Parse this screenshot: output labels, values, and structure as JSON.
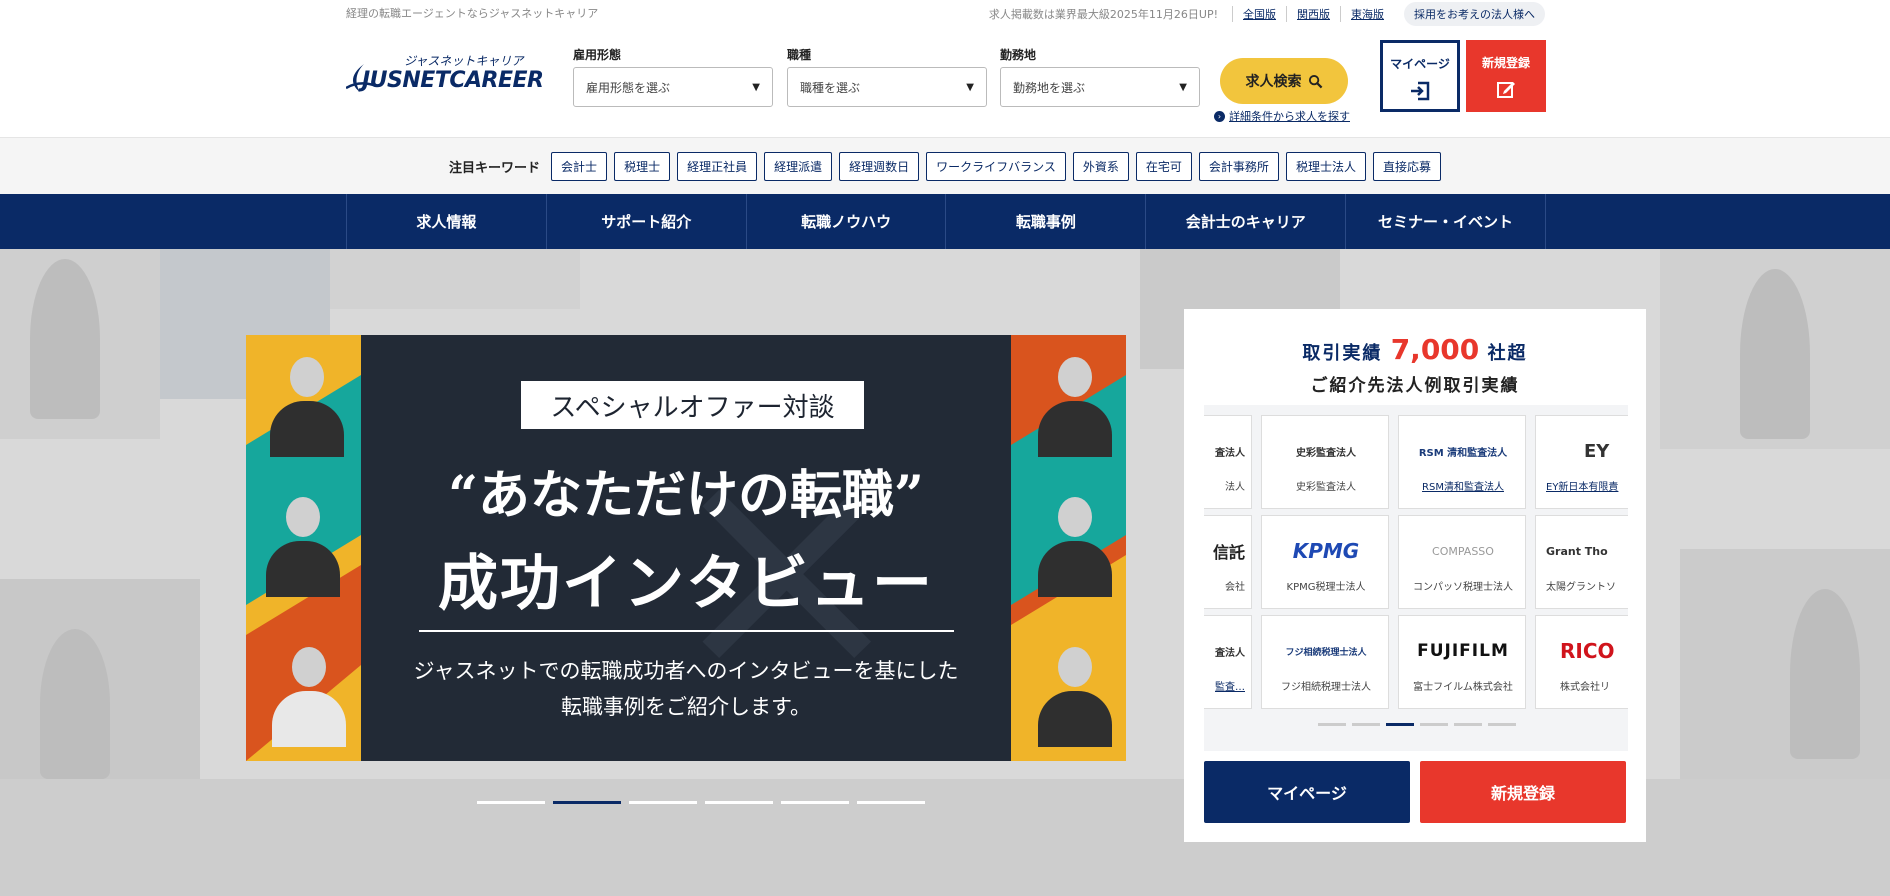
{
  "topbar": {
    "tagline": "経理の転職エージェントならジャスネットキャリア",
    "notice": "求人掲載数は業界最大級2025年11月26日UP!",
    "regions": [
      "全国版",
      "関西版",
      "東海版"
    ],
    "corporate_link": "採用をお考えの法人様へ"
  },
  "logo": {
    "ja": "ジャスネットキャリア",
    "en": "JUSNETCAREER",
    "colors": {
      "navy": "#0a2a66"
    }
  },
  "search": {
    "employment": {
      "label": "雇用形態",
      "placeholder": "雇用形態を選ぶ"
    },
    "job": {
      "label": "職種",
      "placeholder": "職種を選ぶ"
    },
    "location": {
      "label": "勤務地",
      "placeholder": "勤務地を選ぶ"
    },
    "button": "求人検索",
    "detail_link": "詳細条件から求人を探す"
  },
  "header_buttons": {
    "mypage": "マイページ",
    "register": "新規登録"
  },
  "keywords": {
    "label": "注目キーワード",
    "items": [
      "会計士",
      "税理士",
      "経理正社員",
      "経理派遣",
      "経理週数日",
      "ワークライフバランス",
      "外資系",
      "在宅可",
      "会計事務所",
      "税理士法人",
      "直接応募"
    ]
  },
  "nav": [
    "求人情報",
    "サポート紹介",
    "転職ノウハウ",
    "転職事例",
    "会計士のキャリア",
    "セミナー・イベント"
  ],
  "banner": {
    "tag": "スペシャルオファー対談",
    "headline1": "“あなただけの転職”",
    "headline2": "成功インタビュー",
    "sub1": "ジャスネットでの転職成功者へのインタビューを基にした",
    "sub2": "転職事例をご紹介します。",
    "slide_count": 6,
    "active_slide": 2
  },
  "clients": {
    "title_prefix": "取引実績",
    "title_number": "7,000",
    "title_suffix": "社超",
    "subtitle": "ご紹介先法人例取引実績",
    "rows": [
      [
        {
          "logo": "査法人",
          "name": "法人",
          "link": false
        },
        {
          "logo": "史彩監査法人",
          "name": "史彩監査法人",
          "link": false
        },
        {
          "logo": "RSM 清和監査法人",
          "name": "RSM清和監査法人",
          "link": true
        },
        {
          "logo": "EY",
          "name": "EY新日本有限責",
          "link": true
        }
      ],
      [
        {
          "logo": "信託",
          "name": "会社",
          "link": false
        },
        {
          "logo": "KPMG",
          "name": "KPMG税理士法人",
          "link": false
        },
        {
          "logo": "COMPASSO",
          "name": "コンパッソ税理士法人",
          "link": false
        },
        {
          "logo": "Grant Tho",
          "name": "太陽グラントソ",
          "link": false
        }
      ],
      [
        {
          "logo": "査法人",
          "name": "監査…",
          "link": true
        },
        {
          "logo": "フジ相続税理士法人",
          "name": "フジ相続税理士法人",
          "link": false
        },
        {
          "logo": "FUJIFILM",
          "name": "富士フイルム株式会社",
          "link": false
        },
        {
          "logo": "RICO",
          "name": "株式会社リ",
          "link": false
        }
      ]
    ],
    "page_count": 6,
    "active_page": 2,
    "mypage": "マイページ",
    "register": "新規登録"
  }
}
